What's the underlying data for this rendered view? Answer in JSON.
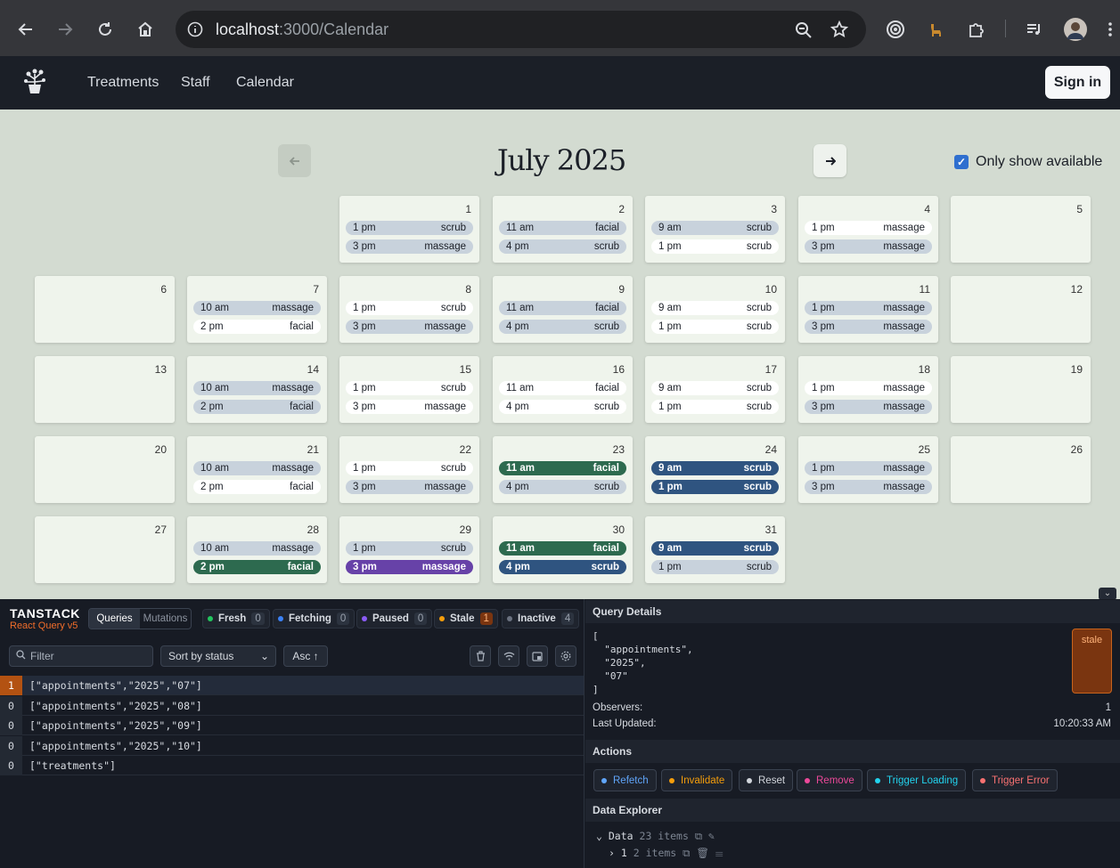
{
  "browser": {
    "url_host": "localhost",
    "url_path": ":3000/Calendar"
  },
  "nav": {
    "links": [
      "Treatments",
      "Staff",
      "Calendar"
    ],
    "sign_in": "Sign in"
  },
  "calendar": {
    "month_label": "July 2025",
    "only_available_label": "Only show available",
    "only_available_checked": true,
    "days": [
      {
        "day": "1",
        "slots": [
          {
            "time": "1 pm",
            "treatment": "scrub",
            "style": "gray"
          },
          {
            "time": "3 pm",
            "treatment": "massage",
            "style": "gray"
          }
        ]
      },
      {
        "day": "2",
        "slots": [
          {
            "time": "11 am",
            "treatment": "facial",
            "style": "gray"
          },
          {
            "time": "4 pm",
            "treatment": "scrub",
            "style": "gray"
          }
        ]
      },
      {
        "day": "3",
        "slots": [
          {
            "time": "9 am",
            "treatment": "scrub",
            "style": "gray"
          },
          {
            "time": "1 pm",
            "treatment": "scrub",
            "style": "white"
          }
        ]
      },
      {
        "day": "4",
        "slots": [
          {
            "time": "1 pm",
            "treatment": "massage",
            "style": "white"
          },
          {
            "time": "3 pm",
            "treatment": "massage",
            "style": "gray"
          }
        ]
      },
      {
        "day": "5",
        "slots": []
      },
      {
        "day": "6",
        "slots": []
      },
      {
        "day": "7",
        "slots": [
          {
            "time": "10 am",
            "treatment": "massage",
            "style": "gray"
          },
          {
            "time": "2 pm",
            "treatment": "facial",
            "style": "white"
          }
        ]
      },
      {
        "day": "8",
        "slots": [
          {
            "time": "1 pm",
            "treatment": "scrub",
            "style": "white"
          },
          {
            "time": "3 pm",
            "treatment": "massage",
            "style": "gray"
          }
        ]
      },
      {
        "day": "9",
        "slots": [
          {
            "time": "11 am",
            "treatment": "facial",
            "style": "gray"
          },
          {
            "time": "4 pm",
            "treatment": "scrub",
            "style": "gray"
          }
        ]
      },
      {
        "day": "10",
        "slots": [
          {
            "time": "9 am",
            "treatment": "scrub",
            "style": "white"
          },
          {
            "time": "1 pm",
            "treatment": "scrub",
            "style": "white"
          }
        ]
      },
      {
        "day": "11",
        "slots": [
          {
            "time": "1 pm",
            "treatment": "massage",
            "style": "gray"
          },
          {
            "time": "3 pm",
            "treatment": "massage",
            "style": "gray"
          }
        ]
      },
      {
        "day": "12",
        "slots": []
      },
      {
        "day": "13",
        "slots": []
      },
      {
        "day": "14",
        "slots": [
          {
            "time": "10 am",
            "treatment": "massage",
            "style": "gray"
          },
          {
            "time": "2 pm",
            "treatment": "facial",
            "style": "gray"
          }
        ]
      },
      {
        "day": "15",
        "slots": [
          {
            "time": "1 pm",
            "treatment": "scrub",
            "style": "white"
          },
          {
            "time": "3 pm",
            "treatment": "massage",
            "style": "white"
          }
        ]
      },
      {
        "day": "16",
        "slots": [
          {
            "time": "11 am",
            "treatment": "facial",
            "style": "white"
          },
          {
            "time": "4 pm",
            "treatment": "scrub",
            "style": "white"
          }
        ]
      },
      {
        "day": "17",
        "slots": [
          {
            "time": "9 am",
            "treatment": "scrub",
            "style": "white"
          },
          {
            "time": "1 pm",
            "treatment": "scrub",
            "style": "white"
          }
        ]
      },
      {
        "day": "18",
        "slots": [
          {
            "time": "1 pm",
            "treatment": "massage",
            "style": "white"
          },
          {
            "time": "3 pm",
            "treatment": "massage",
            "style": "gray"
          }
        ]
      },
      {
        "day": "19",
        "slots": []
      },
      {
        "day": "20",
        "slots": []
      },
      {
        "day": "21",
        "slots": [
          {
            "time": "10 am",
            "treatment": "massage",
            "style": "gray"
          },
          {
            "time": "2 pm",
            "treatment": "facial",
            "style": "white"
          }
        ]
      },
      {
        "day": "22",
        "slots": [
          {
            "time": "1 pm",
            "treatment": "scrub",
            "style": "white"
          },
          {
            "time": "3 pm",
            "treatment": "massage",
            "style": "gray"
          }
        ]
      },
      {
        "day": "23",
        "slots": [
          {
            "time": "11 am",
            "treatment": "facial",
            "style": "green"
          },
          {
            "time": "4 pm",
            "treatment": "scrub",
            "style": "gray"
          }
        ]
      },
      {
        "day": "24",
        "slots": [
          {
            "time": "9 am",
            "treatment": "scrub",
            "style": "blue"
          },
          {
            "time": "1 pm",
            "treatment": "scrub",
            "style": "blue"
          }
        ]
      },
      {
        "day": "25",
        "slots": [
          {
            "time": "1 pm",
            "treatment": "massage",
            "style": "gray"
          },
          {
            "time": "3 pm",
            "treatment": "massage",
            "style": "gray"
          }
        ]
      },
      {
        "day": "26",
        "slots": []
      },
      {
        "day": "27",
        "slots": []
      },
      {
        "day": "28",
        "slots": [
          {
            "time": "10 am",
            "treatment": "massage",
            "style": "gray"
          },
          {
            "time": "2 pm",
            "treatment": "facial",
            "style": "green"
          }
        ]
      },
      {
        "day": "29",
        "slots": [
          {
            "time": "1 pm",
            "treatment": "scrub",
            "style": "gray"
          },
          {
            "time": "3 pm",
            "treatment": "massage",
            "style": "purple"
          }
        ]
      },
      {
        "day": "30",
        "slots": [
          {
            "time": "11 am",
            "treatment": "facial",
            "style": "green"
          },
          {
            "time": "4 pm",
            "treatment": "scrub",
            "style": "blue"
          }
        ]
      },
      {
        "day": "31",
        "slots": [
          {
            "time": "9 am",
            "treatment": "scrub",
            "style": "blue"
          },
          {
            "time": "1 pm",
            "treatment": "scrub",
            "style": "gray"
          }
        ]
      }
    ]
  },
  "devtools": {
    "brand_title": "TANSTACK",
    "brand_sub": "React Query v5",
    "tab_queries": "Queries",
    "tab_mutations": "Mutations",
    "status_pills": [
      {
        "label": "Fresh",
        "count": "0",
        "color": "#22c55e"
      },
      {
        "label": "Fetching",
        "count": "0",
        "color": "#3b82f6"
      },
      {
        "label": "Paused",
        "count": "0",
        "color": "#8b5cf6"
      },
      {
        "label": "Stale",
        "count": "1",
        "color": "#f59e0b"
      },
      {
        "label": "Inactive",
        "count": "4",
        "color": "#6b7280"
      }
    ],
    "filter_placeholder": "Filter",
    "sort_label": "Sort by status",
    "asc_label": "Asc ↑",
    "queries": [
      {
        "count": "1",
        "key": "[\"appointments\",\"2025\",\"07\"]",
        "selected": true
      },
      {
        "count": "0",
        "key": "[\"appointments\",\"2025\",\"08\"]",
        "selected": false
      },
      {
        "count": "0",
        "key": "[\"appointments\",\"2025\",\"09\"]",
        "selected": false
      },
      {
        "count": "0",
        "key": "[\"appointments\",\"2025\",\"10\"]",
        "selected": false
      },
      {
        "count": "0",
        "key": "[\"treatments\"]",
        "selected": false
      }
    ],
    "details": {
      "header": "Query Details",
      "key_json": "[\n  \"appointments\",\n  \"2025\",\n  \"07\"\n]",
      "status_badge": "stale",
      "observers_label": "Observers:",
      "observers_value": "1",
      "updated_label": "Last Updated:",
      "updated_value": "10:20:33 AM"
    },
    "actions_header": "Actions",
    "actions": [
      {
        "label": "Refetch",
        "color": "#60a5fa"
      },
      {
        "label": "Invalidate",
        "color": "#f59e0b"
      },
      {
        "label": "Reset",
        "color": "#d1d5db"
      },
      {
        "label": "Remove",
        "color": "#ec4899"
      },
      {
        "label": "Trigger Loading",
        "color": "#22d3ee"
      },
      {
        "label": "Trigger Error",
        "color": "#f87171"
      }
    ],
    "explorer_header": "Data Explorer",
    "explorer_root": "Data",
    "explorer_root_count": "23 items",
    "explorer_child": "1",
    "explorer_child_count": "2 items"
  }
}
